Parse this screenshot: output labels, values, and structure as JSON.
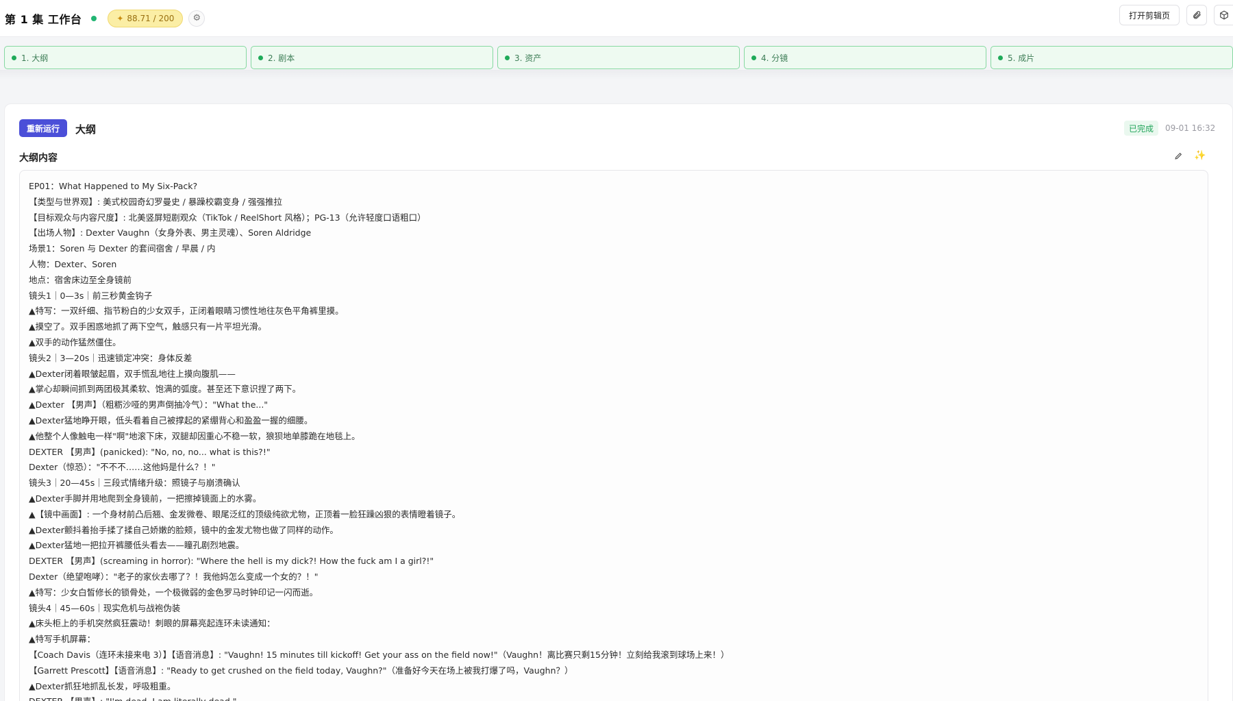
{
  "header": {
    "title": "第 1 集 工作台",
    "credits": "88.71 / 200",
    "open_editor_label": "打开剪辑页",
    "icons": [
      "settings-icon",
      "paperclip-icon",
      "box-icon"
    ]
  },
  "steps": [
    {
      "label": "1. 大纲"
    },
    {
      "label": "2. 剧本"
    },
    {
      "label": "3. 资产"
    },
    {
      "label": "4. 分镜"
    },
    {
      "label": "5. 成片"
    }
  ],
  "card": {
    "rerun_label": "重新运行",
    "title": "大纲",
    "status": "已完成",
    "timestamp": "09-01 16:32",
    "content_label": "大纲内容"
  },
  "outline": [
    "EP01：What Happened to My Six-Pack?",
    "【类型与世界观】: 美式校园奇幻罗曼史 / 暴躁校霸变身 / 强强推拉",
    "【目标观众与内容尺度】: 北美竖屏短剧观众（TikTok / ReelShort 风格）；PG-13（允许轻度口语粗口）",
    "【出场人物】: Dexter Vaughn（女身外表、男主灵魂）、Soren Aldridge",
    "场景1：Soren 与 Dexter 的套间宿舍 / 早晨 / 内",
    "人物：Dexter、Soren",
    "地点：宿舍床边至全身镜前",
    "镜头1｜0—3s｜前三秒黄金钩子",
    "▲特写：一双纤细、指节粉白的少女双手，正闭着眼睛习惯性地往灰色平角裤里摸。",
    "▲摸空了。双手困惑地抓了两下空气，触感只有一片平坦光滑。",
    "▲双手的动作猛然僵住。",
    "镜头2｜3—20s｜迅速锁定冲突：身体反差",
    "▲Dexter闭着眼皱起眉，双手慌乱地往上摸向腹肌——",
    "▲掌心却瞬间抓到两团极其柔软、饱满的弧度。甚至还下意识捏了两下。",
    "▲Dexter 【男声】（粗粝沙哑的男声倒抽冷气）：\"What the...\"",
    "▲Dexter猛地睁开眼，低头看着自己被撑起的紧绷背心和盈盈一握的细腰。",
    "▲他整个人像触电一样\"啊\"地滚下床，双腿却因重心不稳一软，狼狈地单膝跪在地毯上。",
    "DEXTER 【男声】(panicked): \"No, no, no... what is this?!\"",
    "Dexter（惊恐）：\"不不不……这他妈是什么？！\"",
    "镜头3｜20—45s｜三段式情绪升级：照镜子与崩溃确认",
    "▲Dexter手脚并用地爬到全身镜前，一把擦掉镜面上的水雾。",
    "▲【镜中画面】: 一个身材前凸后翘、金发微卷、眼尾泛红的顶级纯欲尤物，正顶着一脸狂躁凶狠的表情瞪着镜子。",
    "▲Dexter颤抖着抬手揉了揉自己娇嫩的脸颊，镜中的金发尤物也做了同样的动作。",
    "▲Dexter猛地一把拉开裤腰低头看去——瞳孔剧烈地震。",
    "DEXTER 【男声】(screaming in horror): \"Where the hell is my dick?! How the fuck am I a girl?!\"",
    "Dexter（绝望咆哮）：\"老子的家伙去哪了？！我他妈怎么变成一个女的？！\"",
    "▲特写：少女白皙修长的锁骨处，一个极微弱的金色罗马时钟印记一闪而逝。",
    "镜头4｜45—60s｜现实危机与战袍伪装",
    "▲床头柜上的手机突然疯狂震动！刺眼的屏幕亮起连环未读通知：",
    "▲特写手机屏幕：",
    "【Coach Davis（连环未接来电 3）】【语音消息】: \"Vaughn! 15 minutes till kickoff! Get your ass on the field now!\"（Vaughn！离比赛只剩15分钟！立刻给我滚到球场上来！）",
    "【Garrett Prescott】【语音消息】: \"Ready to get crushed on the field today, Vaughn?\"（准备好今天在场上被我打爆了吗，Vaughn？）",
    "▲Dexter抓狂地抓乱长发，呼吸粗重。",
    "DEXTER 【男声】: \"I'm dead. I am literally dead.\""
  ]
}
